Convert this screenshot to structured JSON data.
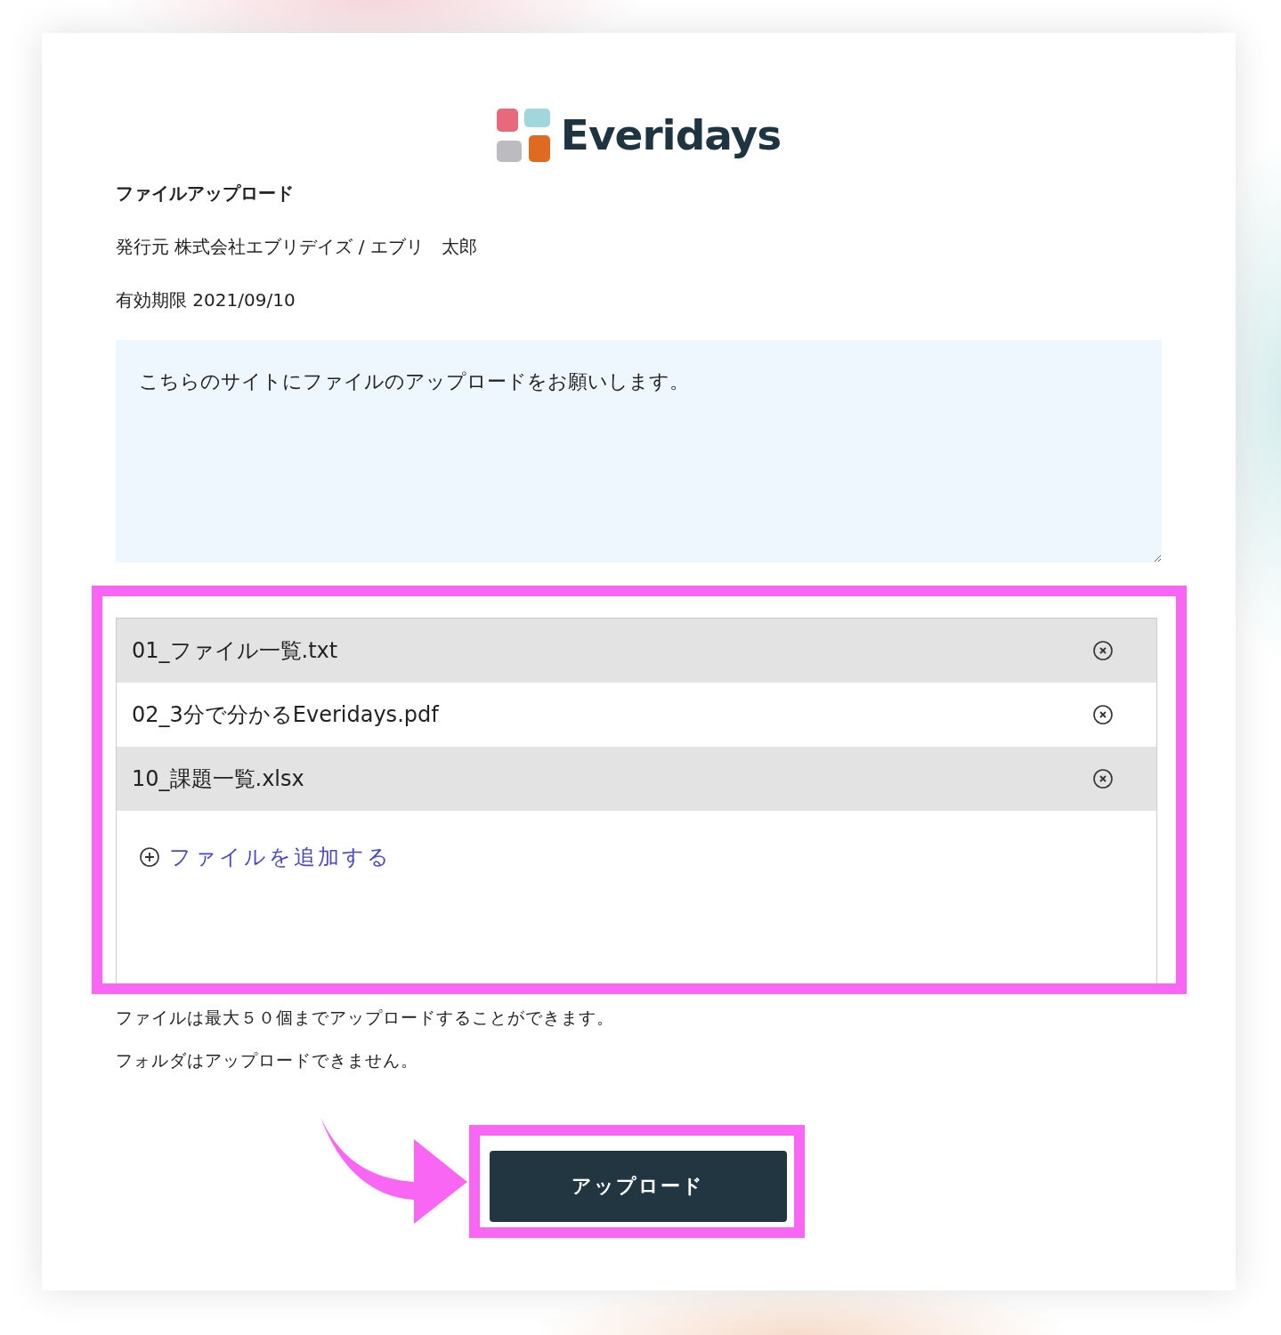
{
  "logo": {
    "text": "Everidays"
  },
  "heading": "ファイルアップロード",
  "issuer": "発行元 株式会社エブリデイズ / エブリ　太郎",
  "expiry": "有効期限 2021/09/10",
  "message": {
    "value": "こちらのサイトにファイルのアップロードをお願いします。"
  },
  "files": [
    {
      "name": "01_ファイル一覧.txt"
    },
    {
      "name": "02_3分で分かるEveridays.pdf"
    },
    {
      "name": "10_課題一覧.xlsx"
    }
  ],
  "add_file": "ファイルを追加する",
  "notes": [
    "ファイルは最大５０個までアップロードすることができます。",
    "フォルダはアップロードできません。"
  ],
  "upload_button": "アップロード"
}
